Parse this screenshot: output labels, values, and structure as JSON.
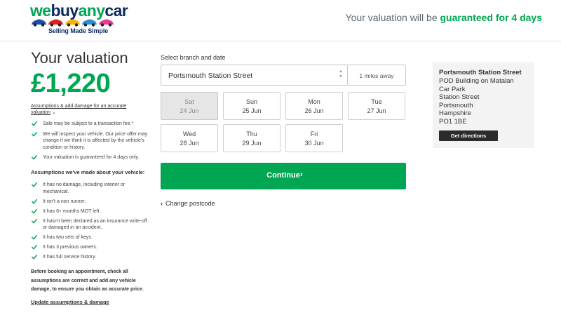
{
  "header": {
    "logo": {
      "we": "we",
      "buy": "buy",
      "any": "any",
      "car": "car",
      "tagline": "Selling Made Simple",
      "car_colors": [
        "#1a4fa3",
        "#e02020",
        "#f5b400",
        "#2a8fd6",
        "#e63c96"
      ]
    },
    "guarantee_prefix": "Your valuation will be ",
    "guarantee_bold": "guaranteed for 4 days"
  },
  "left": {
    "title": "Your valuation",
    "amount": "£1,220",
    "assumptions_link": "Assumptions & add damage for an accurate valuation",
    "notes": [
      "Sale may be subject to a transaction fee.*",
      "We will inspect your vehicle. Our price offer may change if we think it is affected by the vehicle's condition or history.",
      "Your valuation is guaranteed for 4 days only."
    ],
    "assumptions_heading": "Assumptions we've made about your vehicle:",
    "assumptions": [
      "It has no damage, including interior or mechanical.",
      "It isn't a non runner.",
      "It has 6+ months MOT left.",
      "It hasn't been declared as an insurance write-off or damaged in an accident.",
      "It has two sets of keys.",
      "It has 3 previous owners.",
      "It has full service history."
    ],
    "before_text": "Before booking an appointment, check all assumptions are correct and add any vehicle damage, to ensure you obtain an accurate price.",
    "update_link": "Update assumptions & damage"
  },
  "booking": {
    "label": "Select branch and date",
    "branch_value": "Portsmouth Station Street",
    "distance": "1 miles away",
    "days": [
      {
        "day": "Sat",
        "date": "24 Jun",
        "disabled": true
      },
      {
        "day": "Sun",
        "date": "25 Jun",
        "disabled": false
      },
      {
        "day": "Mon",
        "date": "26 Jun",
        "disabled": false
      },
      {
        "day": "Tue",
        "date": "27 Jun",
        "disabled": false
      },
      {
        "day": "Wed",
        "date": "28 Jun",
        "disabled": false
      },
      {
        "day": "Thu",
        "date": "29 Jun",
        "disabled": false
      },
      {
        "day": "Fri",
        "date": "30 Jun",
        "disabled": false
      }
    ],
    "continue_label": "Continue",
    "continue_arrow": "›",
    "change_postcode": "Change postcode"
  },
  "branch_info": {
    "name": "Portsmouth Station Street",
    "address": [
      "POD Building on Matalan",
      "Car Park",
      "Station Street",
      "Portsmouth",
      "Hampshire",
      "PO1 1BE"
    ],
    "directions_label": "Get directions"
  },
  "colors": {
    "brand_green": "#00a651",
    "brand_navy": "#0a2a5e"
  }
}
